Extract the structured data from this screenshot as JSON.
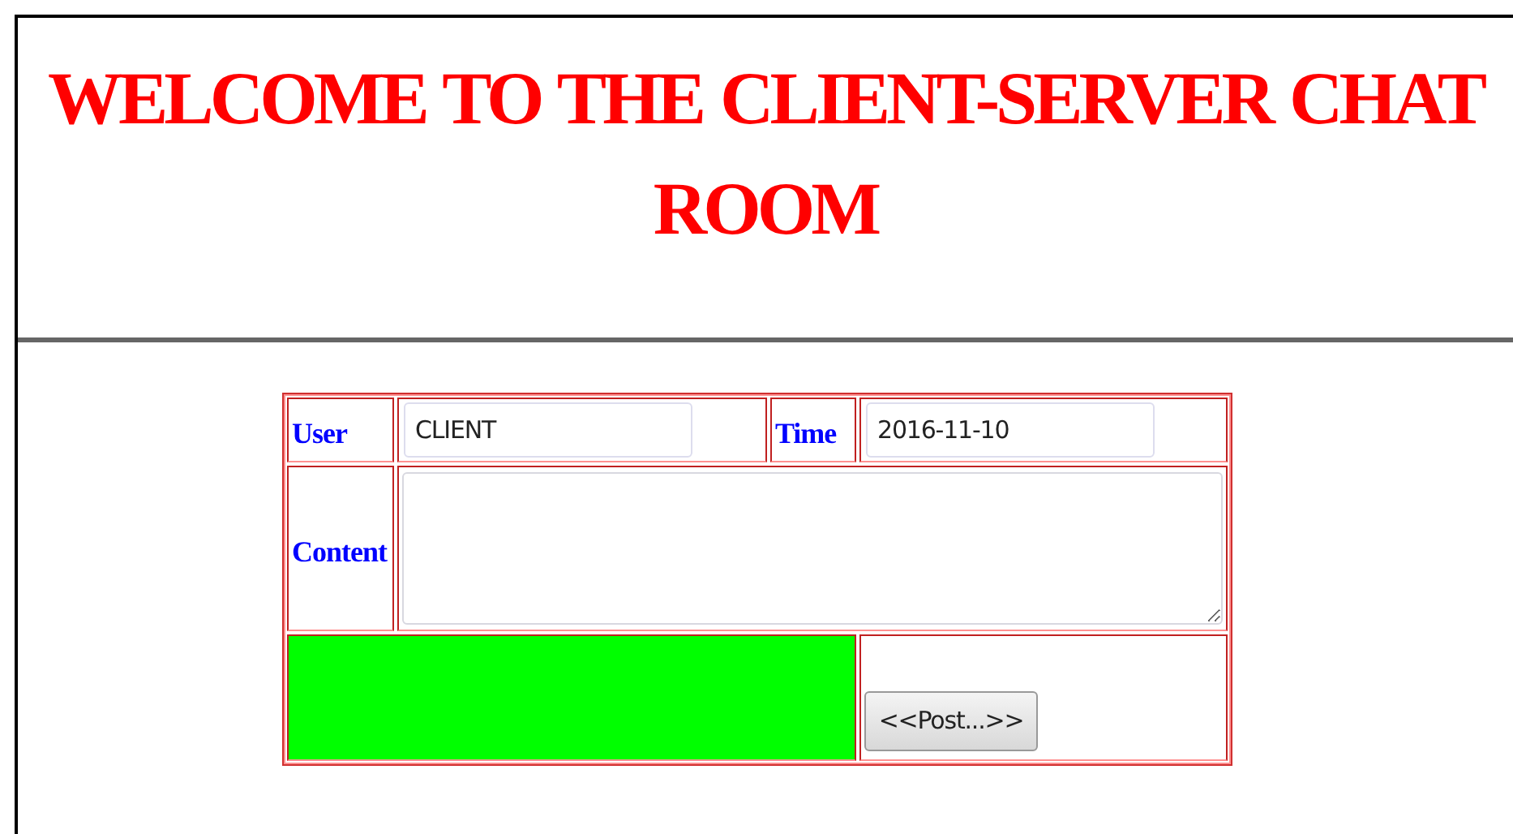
{
  "header": {
    "title": "WELCOME TO THE CLIENT-SERVER CHAT ROOM"
  },
  "form": {
    "user": {
      "label": "User",
      "value": "CLIENT"
    },
    "time": {
      "label": "Time",
      "value": "2016-11-10"
    },
    "content": {
      "label": "Content"
    },
    "status": {
      "color": "#00ff00"
    },
    "post_button": "<<Post...>>"
  }
}
